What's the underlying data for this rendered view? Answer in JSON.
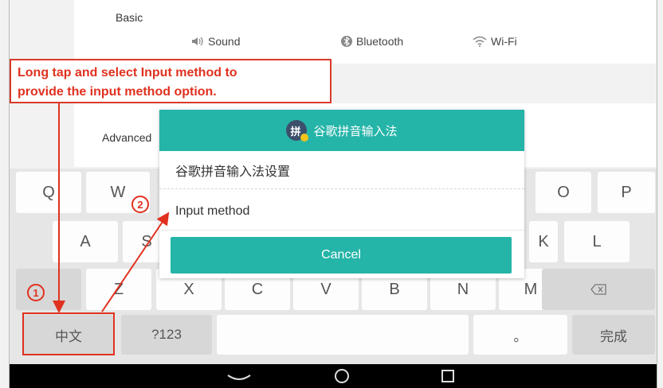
{
  "settings": {
    "basic_label": "Basic",
    "advanced_label": "Advanced",
    "items": [
      {
        "label": "Sound",
        "icon": "speaker-icon"
      },
      {
        "label": "Bluetooth",
        "icon": "bluetooth-icon"
      },
      {
        "label": "Wi-Fi",
        "icon": "wifi-icon"
      }
    ]
  },
  "annotation": {
    "callout_text": "Long tap and select Input method to\nprovide the input method option.",
    "marker_1": "1",
    "marker_2": "2",
    "color": "#e0311f"
  },
  "dialog": {
    "title": "谷歌拼音输入法",
    "logo_glyph": "拼",
    "items": [
      "谷歌拼音输入法设置",
      "Input method"
    ],
    "cancel_label": "Cancel",
    "accent_color": "#25b4a8"
  },
  "keyboard": {
    "row1": [
      "Q",
      "W",
      "O",
      "P"
    ],
    "row2": [
      "A",
      "S",
      "K",
      "L"
    ],
    "row3": [
      "Z",
      "X",
      "C",
      "V",
      "B",
      "N",
      "M"
    ],
    "backspace_icon": "backspace-icon",
    "row4": {
      "lang": "中文",
      "symbols": "?123",
      "period": "。",
      "done": "完成"
    }
  },
  "navbar": {
    "back_icon": "back-chevron-icon",
    "home_icon": "home-circle-icon",
    "recents_icon": "recents-square-icon"
  }
}
